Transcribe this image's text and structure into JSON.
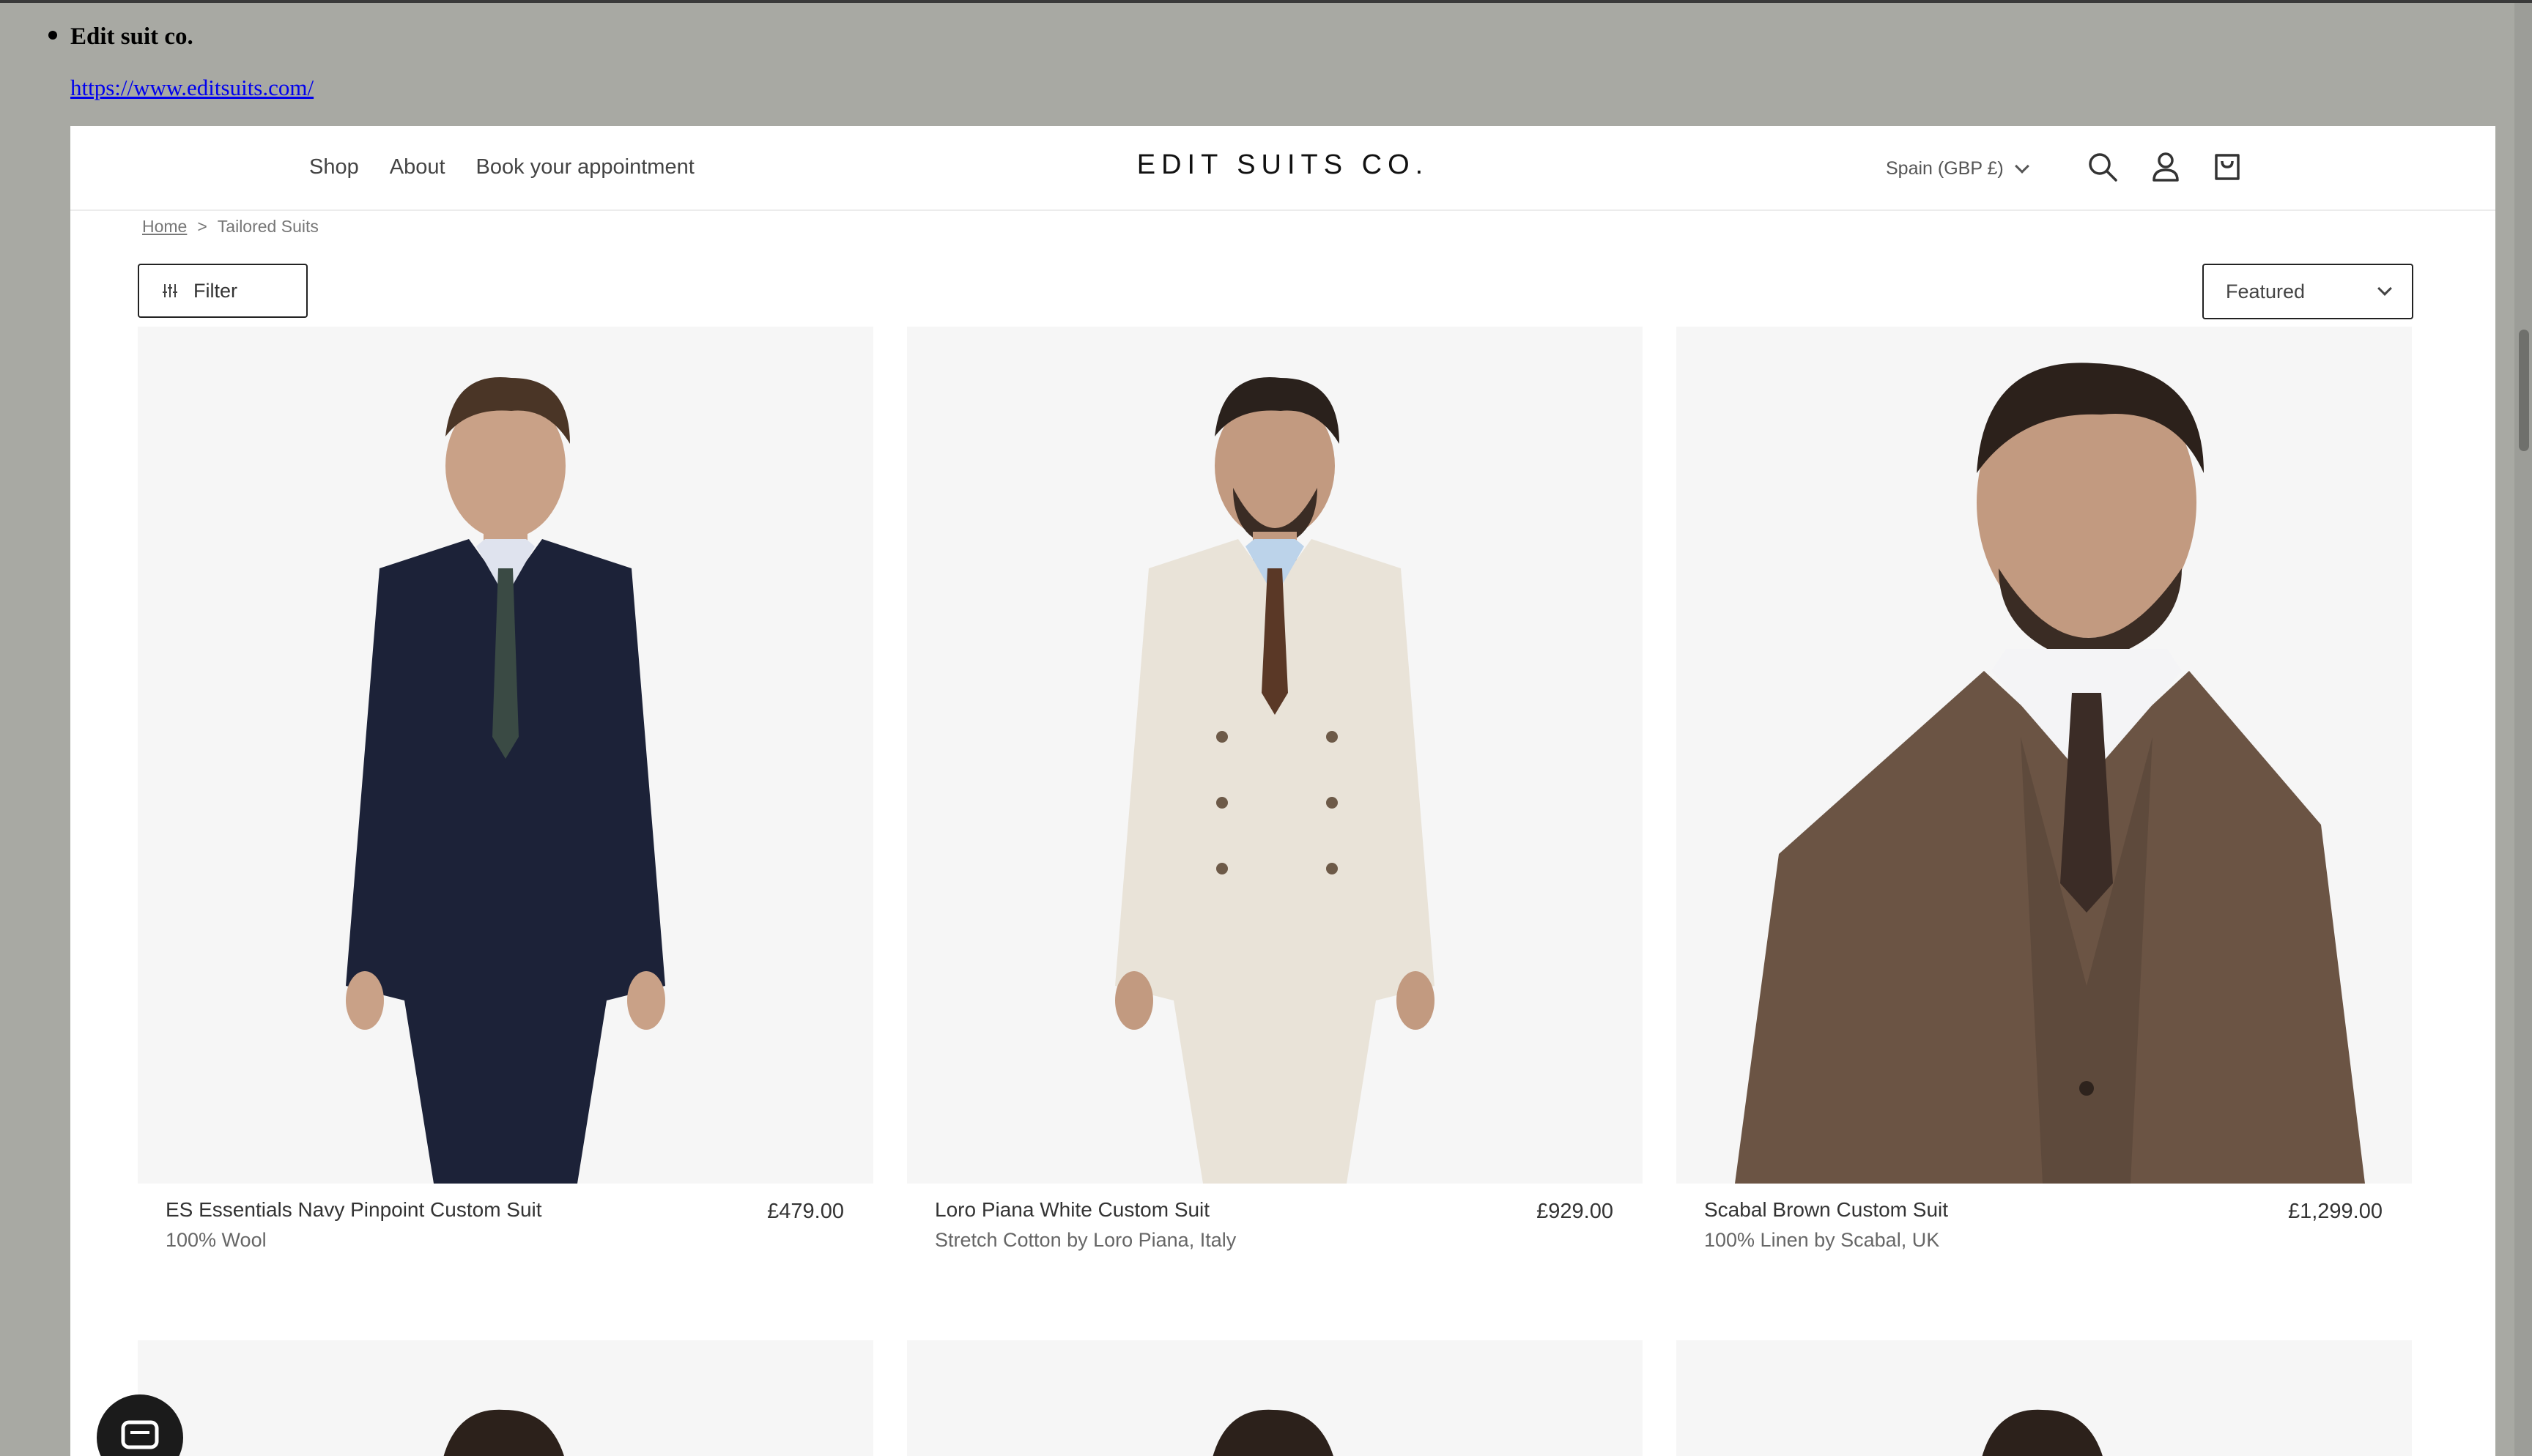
{
  "outer": {
    "title": "Edit suit co.",
    "link": "https://www.editsuits.com/"
  },
  "header": {
    "nav": [
      "Shop",
      "About",
      "Book your appointment"
    ],
    "logo": "EDIT SUITS CO.",
    "locale": "Spain (GBP £)",
    "icons": [
      "search-icon",
      "account-icon",
      "cart-icon"
    ]
  },
  "breadcrumb": {
    "home": "Home",
    "separator": ">",
    "current": "Tailored Suits"
  },
  "toolbar": {
    "filter_label": "Filter",
    "sort_value": "Featured"
  },
  "products": [
    {
      "name": "ES Essentials Navy Pinpoint Custom Suit",
      "desc": "100% Wool",
      "price": "£479.00",
      "suit_color": "#1c2238",
      "tie_color": "#3a4a44"
    },
    {
      "name": "Loro Piana White Custom Suit",
      "desc": "Stretch Cotton by Loro Piana, Italy",
      "price": "£929.00",
      "suit_color": "#e9e3d8",
      "tie_color": "#5a3826"
    },
    {
      "name": "Scabal Brown Custom Suit",
      "desc": "100% Linen by Scabal, UK",
      "price": "£1,299.00",
      "suit_color": "#6b5444",
      "tie_color": "#3b2c26"
    }
  ],
  "colors": {
    "page_bg": "#a8a9a3",
    "frame_bg": "#ffffff",
    "card_bg": "#f6f6f6",
    "text": "#333333"
  }
}
